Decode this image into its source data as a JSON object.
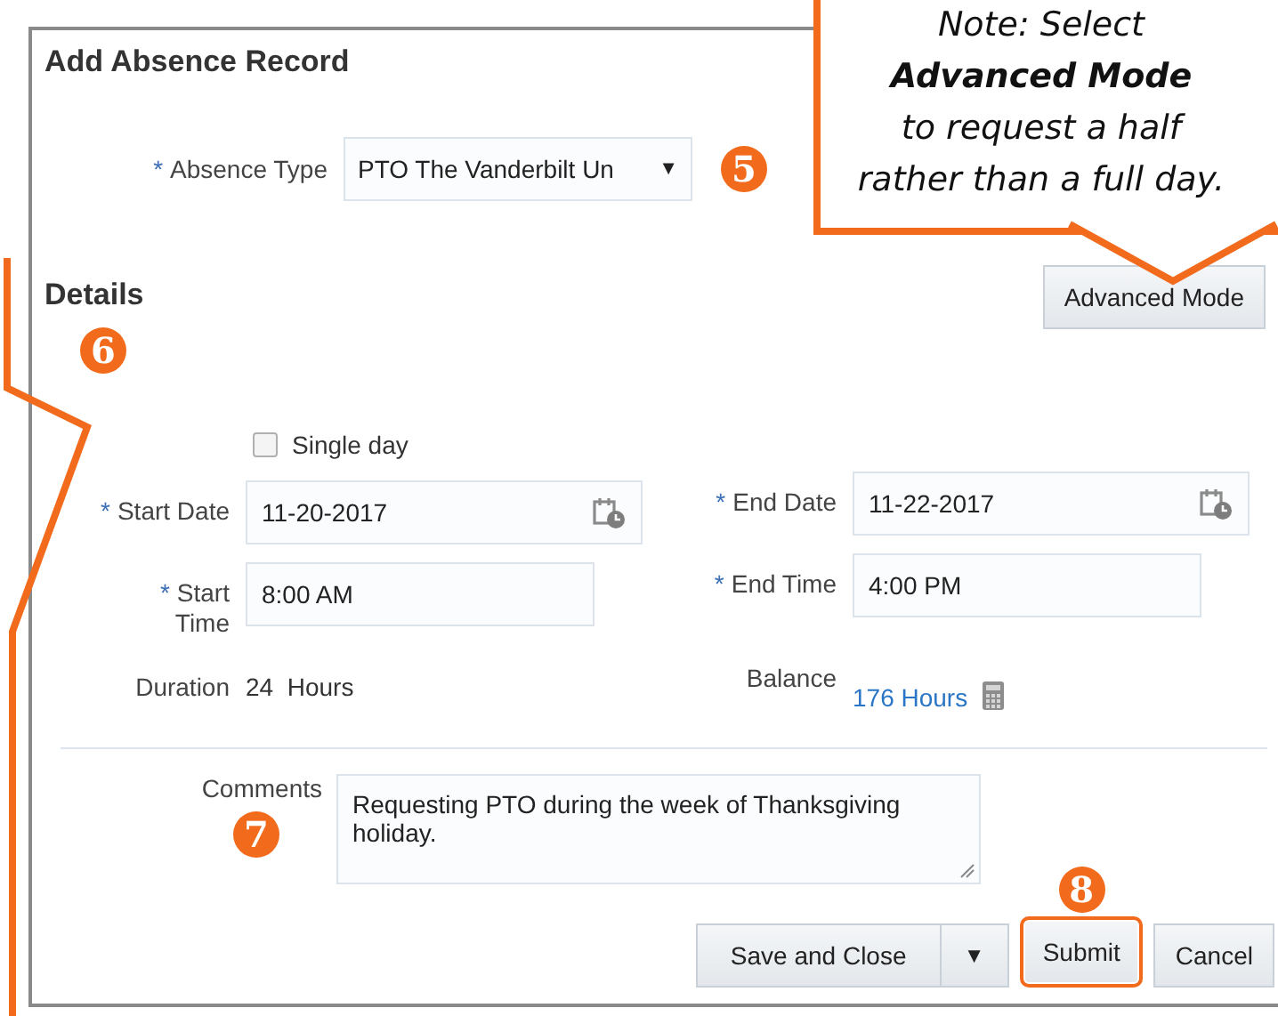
{
  "dialog": {
    "title": "Add Absence Record"
  },
  "absence_type": {
    "label": "Absence Type",
    "required_mark": "*",
    "value": "PTO The Vanderbilt Un",
    "glyph": "▼",
    "step": "5"
  },
  "details": {
    "heading": "Details",
    "step": "6"
  },
  "advanced_mode_button": "Advanced Mode",
  "note": {
    "text": "Note: Select **Advanced Mode** to request a half\nrather than a full day."
  },
  "single_day": {
    "label": "Single day",
    "checked": false
  },
  "rows": [
    {
      "left": {
        "kind": "date",
        "label": "Start Date",
        "required_mark": "*",
        "value": "11-20-2017"
      },
      "right": {
        "kind": "date",
        "label": "End Date",
        "required_mark": "*",
        "value": "11-22-2017"
      }
    },
    {
      "left": {
        "kind": "time",
        "label": "Start\nTime",
        "required_mark": "*",
        "value": "8:00 AM"
      },
      "right": {
        "kind": "time",
        "label": "End Time",
        "required_mark": "*",
        "value": "4:00 PM"
      }
    },
    {
      "left": {
        "kind": "text",
        "label": "Duration",
        "value": "24  Hours"
      },
      "right": {
        "kind": "link",
        "label": "Balance",
        "value": "176 Hours"
      }
    }
  ],
  "comments": {
    "label": "Comments",
    "value": "Requesting PTO during the week of Thanksgiving holiday.",
    "step": "7"
  },
  "buttons": [
    {
      "kind": "split",
      "label": "Save and Close",
      "glyph": "▼",
      "highlighted": false
    },
    {
      "kind": "plain",
      "label": "Submit",
      "highlighted": true,
      "step": "8"
    },
    {
      "kind": "plain",
      "label": "Cancel",
      "highlighted": false
    }
  ]
}
